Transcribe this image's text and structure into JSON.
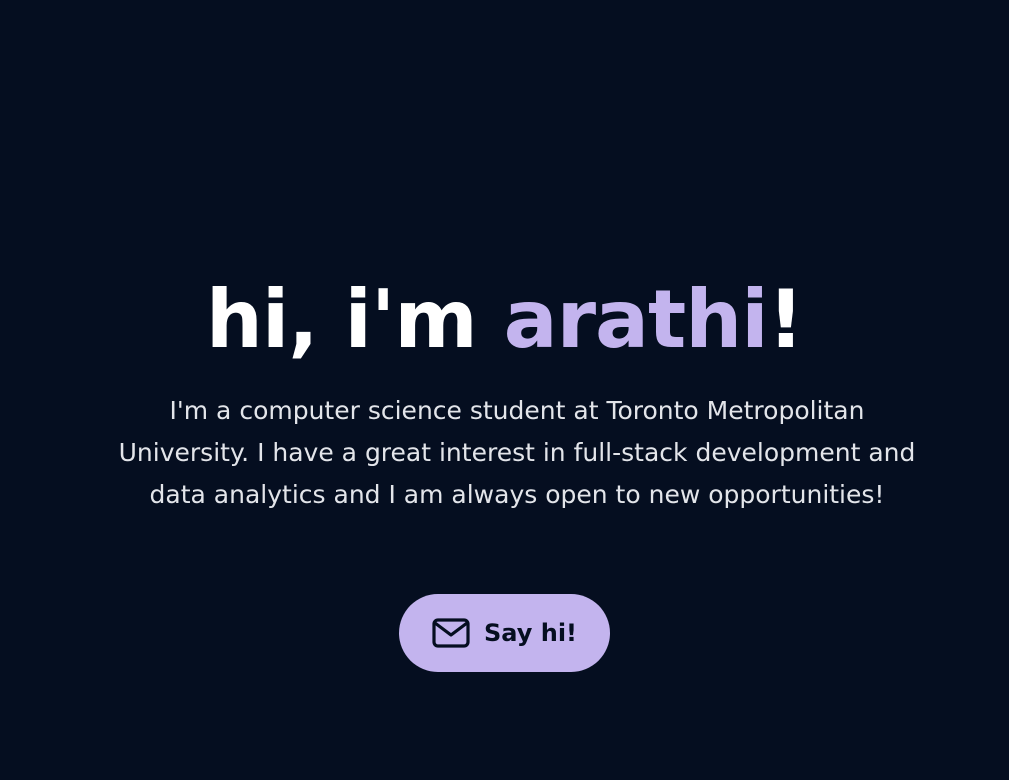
{
  "hero": {
    "greeting": "hi, i'm ",
    "name": "arathi",
    "exclamation": "!",
    "bio": "I'm a computer science student at Toronto Metropolitan University. I have a great interest in full-stack development and data analytics and I am always open to new opportunities!",
    "cta": {
      "label": "Say hi!",
      "icon": "mail-icon"
    }
  },
  "colors": {
    "background": "#050e20",
    "accent": "#c3b4ee",
    "heading": "#ffffff",
    "body_text": "#e3e5ea"
  }
}
